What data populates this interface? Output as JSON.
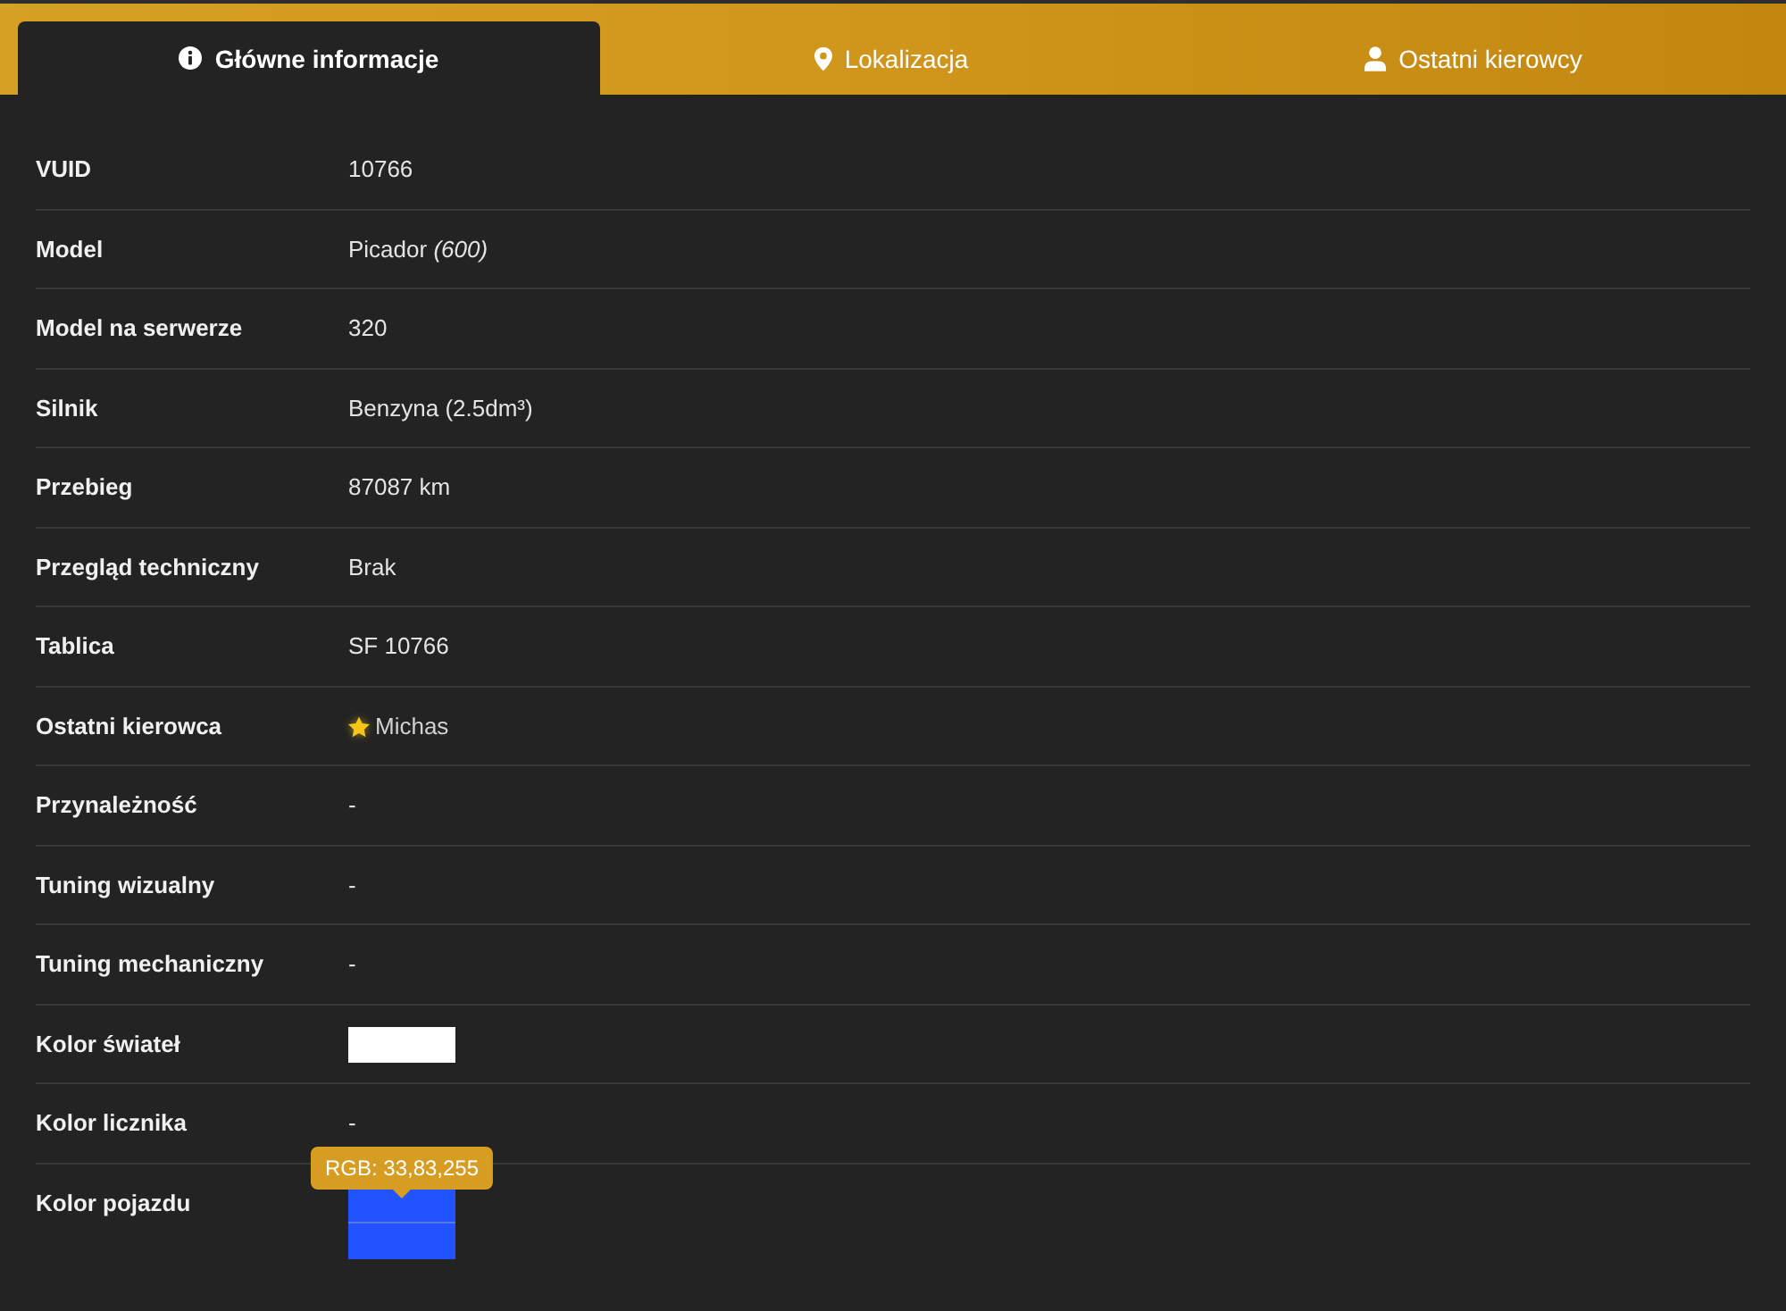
{
  "tabs": [
    {
      "label": "Główne informacje",
      "selected": true
    },
    {
      "label": "Lokalizacja",
      "selected": false
    },
    {
      "label": "Ostatni kierowcy",
      "selected": false
    }
  ],
  "rows": [
    {
      "label": "VUID",
      "kind": "text",
      "value": "10766"
    },
    {
      "label": "Model",
      "kind": "text",
      "value": "Picador *(600)*"
    },
    {
      "label": "Model na serwerze",
      "kind": "text",
      "value": "320"
    },
    {
      "label": "Silnik",
      "kind": "text",
      "value": "Benzyna (2.5dm³)"
    },
    {
      "label": "Przebieg",
      "kind": "text",
      "value": "87087 km"
    },
    {
      "label": "Przegląd techniczny",
      "kind": "text",
      "value": "Brak"
    },
    {
      "label": "Tablica",
      "kind": "text",
      "value": "SF 10766"
    },
    {
      "label": "Ostatni kierowca",
      "kind": "driver",
      "value": "Michas",
      "starred": true
    },
    {
      "label": "Przynależność",
      "kind": "text",
      "value": "-"
    },
    {
      "label": "Tuning wizualny",
      "kind": "text",
      "value": "-"
    },
    {
      "label": "Tuning mechaniczny",
      "kind": "text",
      "value": "-"
    },
    {
      "label": "Kolor świateł",
      "kind": "swatches",
      "swatches": [
        {
          "color": "#ffffff"
        }
      ]
    },
    {
      "label": "Kolor licznika",
      "kind": "text",
      "value": "-"
    },
    {
      "label": "Kolor pojazdu",
      "kind": "swatches",
      "swatches": [
        {
          "color": "#2153ff",
          "tooltip": "RGB: 33,83,255"
        },
        {
          "color": "#2153ff"
        }
      ]
    }
  ]
}
